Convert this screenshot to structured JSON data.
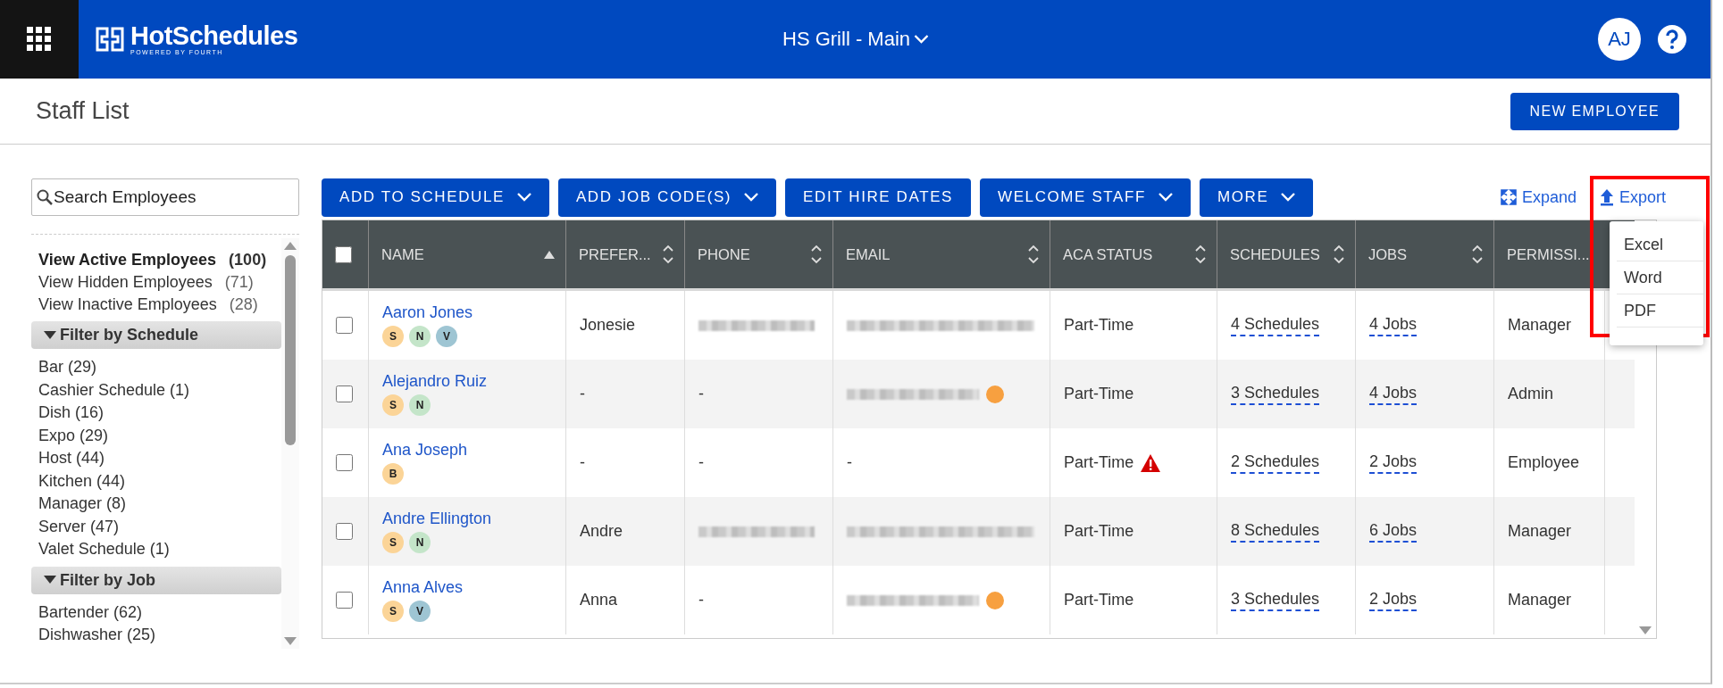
{
  "header": {
    "logo": "HotSchedules",
    "logo_tagline": "POWERED BY FOURTH",
    "location": "HS Grill - Main",
    "avatar": "AJ"
  },
  "page": {
    "title": "Staff List",
    "primary_button": "NEW EMPLOYEE"
  },
  "sidebar": {
    "search": {
      "placeholder": "Search Employees"
    },
    "views": [
      {
        "label": "View Active Employees",
        "count": "(100)",
        "selected": true
      },
      {
        "label": "View Hidden Employees",
        "count": "(71)",
        "selected": false
      },
      {
        "label": "View Inactive Employees",
        "count": "(28)",
        "selected": false
      }
    ],
    "filters": [
      {
        "title": "Filter by Schedule",
        "expanded": true,
        "items": [
          "Bar (29)",
          "Cashier Schedule (1)",
          "Dish (16)",
          "Expo (29)",
          "Host (44)",
          "Kitchen (44)",
          "Manager (8)",
          "Server (47)",
          "Valet Schedule (1)"
        ]
      },
      {
        "title": "Filter by Job",
        "expanded": true,
        "items": [
          "Bartender (62)",
          "Dishwasher (25)"
        ]
      }
    ]
  },
  "toolbar": {
    "buttons": [
      {
        "label": "ADD TO SCHEDULE",
        "dropdown": true
      },
      {
        "label": "ADD JOB CODE(S)",
        "dropdown": true
      },
      {
        "label": "EDIT HIRE DATES",
        "dropdown": false
      },
      {
        "label": "WELCOME STAFF",
        "dropdown": true
      },
      {
        "label": "MORE",
        "dropdown": true
      }
    ],
    "expand": "Expand",
    "export": "Export"
  },
  "export_menu": {
    "items": [
      "Excel",
      "Word",
      "PDF"
    ],
    "highlighted": true
  },
  "table": {
    "all_checked": false,
    "columns": [
      {
        "label": "NAME",
        "sortable": true,
        "sorted": true
      },
      {
        "label": "PREFER...",
        "sortable": true,
        "sorted": false
      },
      {
        "label": "PHONE",
        "sortable": true,
        "sorted": false
      },
      {
        "label": "EMAIL",
        "sortable": true,
        "sorted": false
      },
      {
        "label": "ACA STATUS",
        "sortable": true,
        "sorted": false
      },
      {
        "label": "SCHEDULES",
        "sortable": true,
        "sorted": false
      },
      {
        "label": "JOBS",
        "sortable": true,
        "sorted": false
      },
      {
        "label": "PERMISSI...",
        "sortable": false
      }
    ],
    "rows": [
      {
        "checked": false,
        "name": "Aaron Jones",
        "badges": [
          {
            "letter": "S",
            "color": "#fbd497"
          },
          {
            "letter": "N",
            "color": "#c4e5c9"
          },
          {
            "letter": "V",
            "color": "#9ec5d3"
          }
        ],
        "preferred": "Jonesie",
        "phone": {
          "kind": "redacted"
        },
        "email": {
          "kind": "redacted",
          "flagged": false
        },
        "aca": "Part-Time",
        "aca_warning": false,
        "schedules": "4 Schedules",
        "jobs": "4 Jobs",
        "permission": "Manager"
      },
      {
        "checked": false,
        "name": "Alejandro Ruiz",
        "badges": [
          {
            "letter": "S",
            "color": "#fbd497"
          },
          {
            "letter": "N",
            "color": "#c4e5c9"
          }
        ],
        "preferred": "-",
        "phone": {
          "kind": "text",
          "text": "-"
        },
        "email": {
          "kind": "redacted",
          "flagged": true
        },
        "aca": "Part-Time",
        "aca_warning": false,
        "schedules": "3 Schedules",
        "jobs": "4 Jobs",
        "permission": "Admin"
      },
      {
        "checked": false,
        "name": "Ana Joseph",
        "badges": [
          {
            "letter": "B",
            "color": "#fbd497"
          }
        ],
        "preferred": "-",
        "phone": {
          "kind": "text",
          "text": "-"
        },
        "email": {
          "kind": "text",
          "text": "-"
        },
        "aca": "Part-Time",
        "aca_warning": true,
        "schedules": "2 Schedules",
        "jobs": "2 Jobs",
        "permission": "Employee"
      },
      {
        "checked": false,
        "name": "Andre Ellington",
        "badges": [
          {
            "letter": "S",
            "color": "#fbd497"
          },
          {
            "letter": "N",
            "color": "#c4e5c9"
          }
        ],
        "preferred": "Andre",
        "phone": {
          "kind": "redacted"
        },
        "email": {
          "kind": "redacted",
          "flagged": false
        },
        "aca": "Part-Time",
        "aca_warning": false,
        "schedules": "8 Schedules",
        "jobs": "6 Jobs",
        "permission": "Manager"
      },
      {
        "checked": false,
        "name": "Anna Alves",
        "badges": [
          {
            "letter": "S",
            "color": "#fbd497"
          },
          {
            "letter": "V",
            "color": "#9ec5d3"
          }
        ],
        "preferred": "Anna",
        "phone": {
          "kind": "text",
          "text": "-"
        },
        "email": {
          "kind": "redacted",
          "flagged": true
        },
        "aca": "Part-Time",
        "aca_warning": false,
        "schedules": "3 Schedules",
        "jobs": "2 Jobs",
        "permission": "Manager"
      }
    ]
  }
}
